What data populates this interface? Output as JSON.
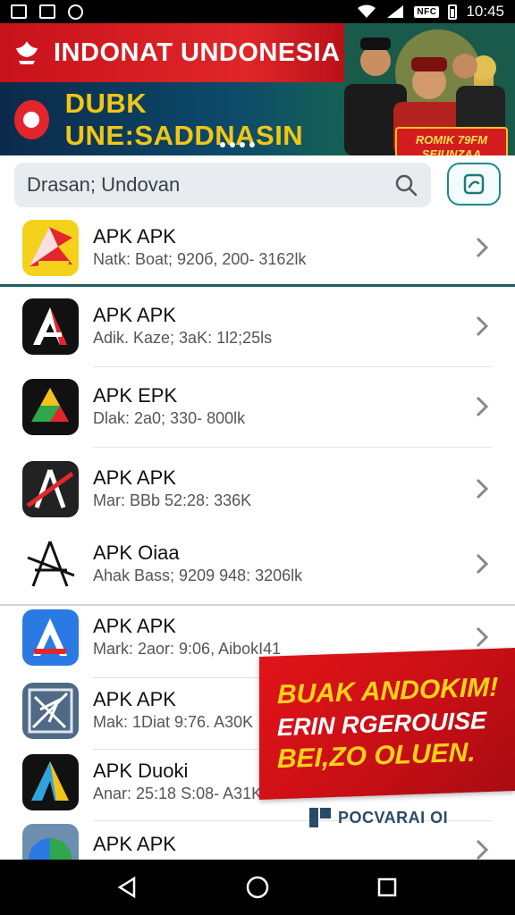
{
  "status_bar": {
    "time": "10:45",
    "nfc_label": "NFC"
  },
  "banner": {
    "title": "INDONAT UNDONESIA",
    "subtitle": "DUBK UNE:SADDNASIN",
    "badge_line1": "ROMIK 79FM",
    "badge_line2": "SEIUNZAA"
  },
  "search": {
    "value": "Drasan; Undovan",
    "search_icon": "search-icon",
    "scan_icon": "scan-icon"
  },
  "apps": [
    {
      "name": "APK APK",
      "meta": "Natk: Boat; 920б, 200- 3162lk",
      "icon": "red-flag-app-icon"
    },
    {
      "name": "APK APK",
      "meta": "Adik. Kaze; 3aK: 1l2;25ls",
      "icon": "red-a-app-icon"
    },
    {
      "name": "APK EPK",
      "meta": "Dlak: 2a0; 330- 800lk",
      "icon": "triangle-drive-app-icon"
    },
    {
      "name": "APK APK",
      "meta": "Mar: BBb 52:28: 336K",
      "icon": "red-slash-a-app-icon"
    },
    {
      "name": "APK Oiaa",
      "meta": "Ahak Bass; 9209 948: 3206lk",
      "icon": "sketch-a-app-icon"
    },
    {
      "name": "APK APK",
      "meta": "Mark: 2aor: 9:06, AibokI41",
      "icon": "blue-a-app-icon"
    },
    {
      "name": "APK APK",
      "meta": "Mak: 1Diat 9:76. A30K",
      "icon": "scribble-app-icon"
    },
    {
      "name": "APK Duoki",
      "meta": "Anar: 25:18 S:08- A31K",
      "icon": "yellow-blue-a-app-icon"
    },
    {
      "name": "APK APK",
      "meta": "",
      "icon": "colorful-globe-app-icon"
    }
  ],
  "ad": {
    "line1": "BUAK ANDOKIM!",
    "line2": "ERIN RGEROUISE",
    "line3": "BEI,ZO OLUEN.",
    "brand": "POCVARAI OI"
  },
  "colors": {
    "banner_red": "#d41c20",
    "accent_teal": "#1a8a8a",
    "ad_yellow": "#ffd21a"
  }
}
